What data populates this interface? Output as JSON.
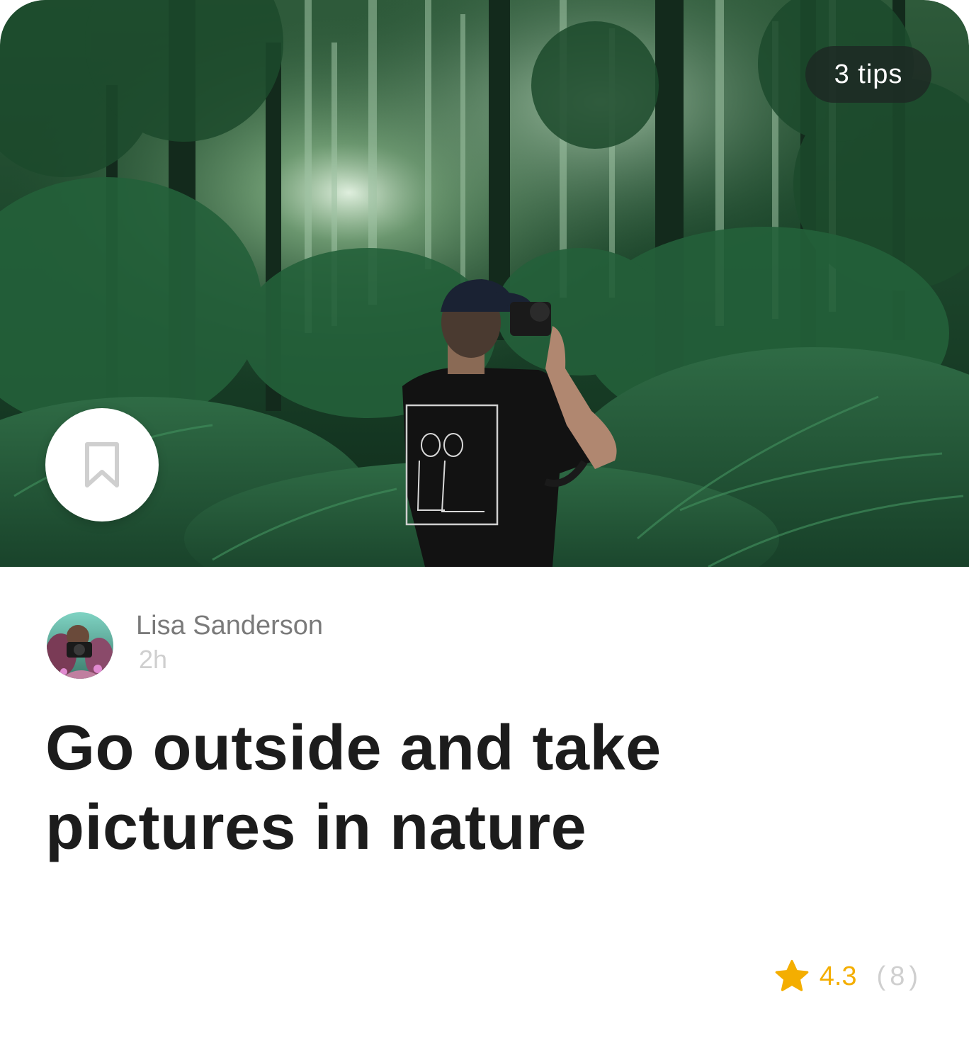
{
  "card": {
    "tips_badge": "3 tips",
    "author": {
      "name": "Lisa Sanderson",
      "time": "2h"
    },
    "title": "Go outside and take pictures in nature",
    "rating": {
      "value": "4.3",
      "count": "(8)"
    }
  },
  "icons": {
    "bookmark": "bookmark-icon",
    "star": "star-icon",
    "avatar": "avatar-photo",
    "hero": "forest-photographer-photo"
  },
  "colors": {
    "accent_star": "#f4ae00",
    "title_text": "#1c1c1c",
    "muted_text": "#7a7a7a",
    "faint_text": "#cfcfcf",
    "badge_bg": "#1e2622"
  }
}
